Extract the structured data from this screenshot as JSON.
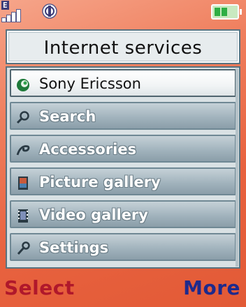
{
  "status": {
    "network_indicator": "E",
    "signal_bars": 4,
    "icons": [
      "signal-icon",
      "network-status-icon",
      "battery-icon"
    ],
    "battery_level": 0.67
  },
  "screen": {
    "title": "Internet services"
  },
  "menu": {
    "items": [
      {
        "label": "Sony Ericsson",
        "icon": "sony-ericsson-logo-icon",
        "selected": true
      },
      {
        "label": "Search",
        "icon": "search-icon",
        "selected": false
      },
      {
        "label": "Accessories",
        "icon": "accessories-icon",
        "selected": false
      },
      {
        "label": "Picture gallery",
        "icon": "picture-gallery-icon",
        "selected": false
      },
      {
        "label": "Video gallery",
        "icon": "video-gallery-icon",
        "selected": false
      },
      {
        "label": "Settings",
        "icon": "settings-wrench-icon",
        "selected": false
      }
    ]
  },
  "softkeys": {
    "left": "Select",
    "right": "More"
  },
  "colors": {
    "background": "#e8623f",
    "left_softkey": "#b0182b",
    "right_softkey": "#1e2a8c",
    "frame_border": "#5a7380"
  }
}
